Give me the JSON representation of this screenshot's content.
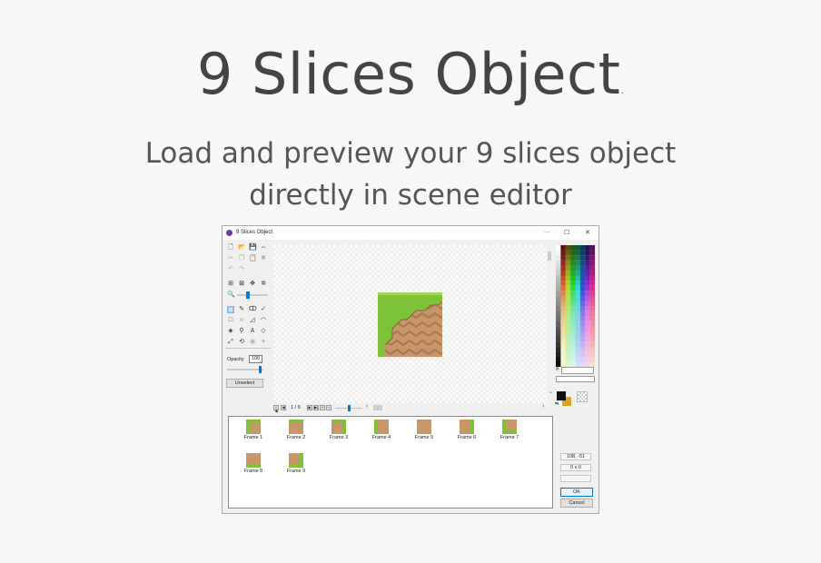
{
  "hero": {
    "title": "9 Slices Object",
    "title_dot": ".",
    "subtitle_line1": "Load and preview your 9 slices object",
    "subtitle_line2": "directly in scene editor"
  },
  "window": {
    "title": "9 Slices Object",
    "minimize": "—",
    "maximize": "☐",
    "close": "✕"
  },
  "tools": {
    "opacity_label": "Opacity",
    "opacity_value": "100",
    "unselect_label": "Unselect",
    "zoom_level_fraction": 0.35
  },
  "pagebar": {
    "page_indicator": "1 / 9",
    "first": "|◀",
    "prev": "◀",
    "next": "▶",
    "last": "▶|",
    "add": "+",
    "remove": "−"
  },
  "frames": [
    {
      "label": "Frame 1"
    },
    {
      "label": "Frame 2"
    },
    {
      "label": "Frame 3"
    },
    {
      "label": "Frame 4"
    },
    {
      "label": "Frame 5"
    },
    {
      "label": "Frame 6"
    },
    {
      "label": "Frame 7"
    },
    {
      "label": "Frame 8"
    },
    {
      "label": "Frame 9"
    }
  ],
  "side": {
    "hex_label": "#",
    "coords": "108, -51",
    "size": "0 x 0",
    "ok_label": "OK",
    "cancel_label": "Cancel"
  },
  "colors": {
    "grass": "#7ec23a",
    "dirt": "#c7976a",
    "foreground": "#111111",
    "background": "#d9a521",
    "accent": "#0078d7"
  }
}
